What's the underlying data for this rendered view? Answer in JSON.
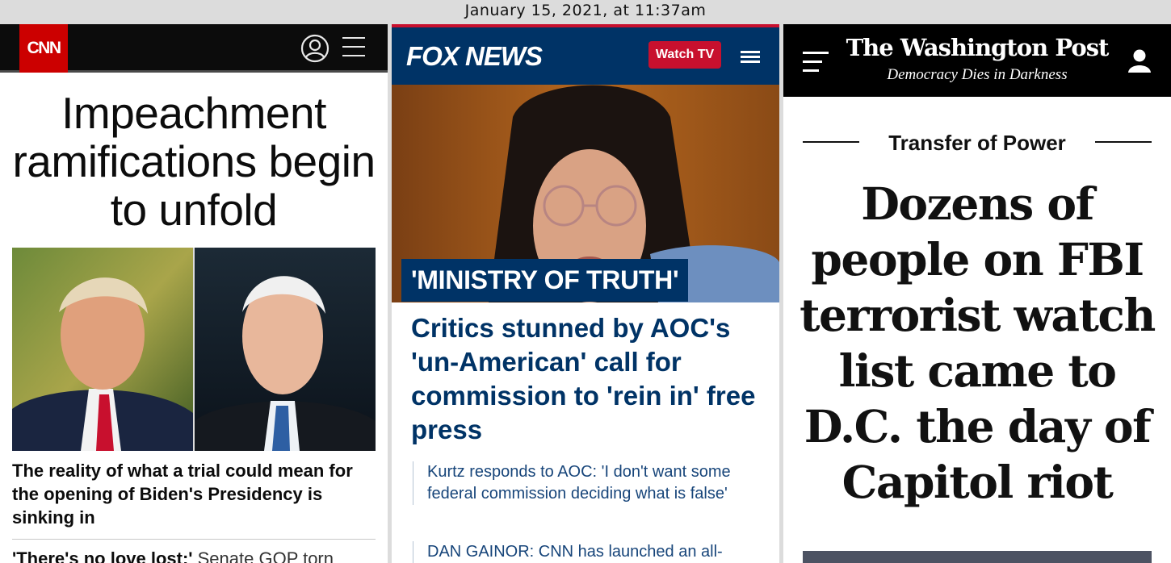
{
  "timestamp": "January 15, 2021, at 11:37am",
  "cnn": {
    "logo": "CNN",
    "icons": {
      "account": "account-circle-icon",
      "menu": "hamburger-menu-icon"
    },
    "headline": "Impeachment ramifications begin to unfold",
    "story": "The reality of what a trial could mean for the opening of Biden's Presidency is sinking in",
    "story2_bold": "'There's no love lost:'",
    "story2_rest": " Senate GOP torn",
    "colors": {
      "brand": "#cc0000",
      "bar": "#0c0c0c"
    }
  },
  "fox": {
    "logo": "FOX NEWS",
    "watch_tv": "Watch TV",
    "icons": {
      "menu": "hamburger-menu-icon"
    },
    "kicker": "'MINISTRY OF TRUTH'",
    "headline": "Critics stunned by AOC's 'un-American' call for commission to 'rein in' free press",
    "related": [
      "Kurtz responds to AOC: 'I don't want some federal commission deciding what is false'",
      "DAN GAINOR: CNN has launched an all-"
    ],
    "colors": {
      "brand": "#003366",
      "accent": "#c8102e"
    }
  },
  "wapo": {
    "logo": "The Washington Post",
    "tagline": "Democracy Dies in Darkness",
    "icons": {
      "menu": "hamburger-menu-icon",
      "account": "user-icon"
    },
    "kicker": "Transfer of Power",
    "headline": "Dozens of people on FBI terrorist watch list came to D.C. the day of Capitol riot",
    "colors": {
      "bar": "#000000"
    }
  }
}
